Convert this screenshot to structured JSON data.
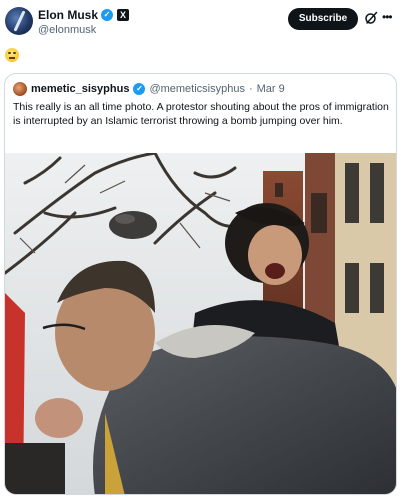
{
  "author": {
    "name": "Elon Musk",
    "handle": "@elonmusk"
  },
  "actions": {
    "subscribe_label": "Subscribe"
  },
  "post": {
    "emoji": "😑"
  },
  "quoted": {
    "name": "memetic_sisyphus",
    "handle": "@memeticsisyphus",
    "separator": "·",
    "date": "Mar 9",
    "text": "This really is an all time photo. A protestor shouting about the pros of immigration is interrupted by an Islamic terrorist throwing a bomb jumping over him."
  },
  "icons": {
    "verified": "verified-badge-icon",
    "affiliate": "x-affiliate-icon",
    "grok": "grok-icon",
    "more": "more-options-icon"
  },
  "colors": {
    "accent": "#1d9bf0",
    "subscribe_bg": "#0f1419",
    "muted_text": "#536471"
  }
}
